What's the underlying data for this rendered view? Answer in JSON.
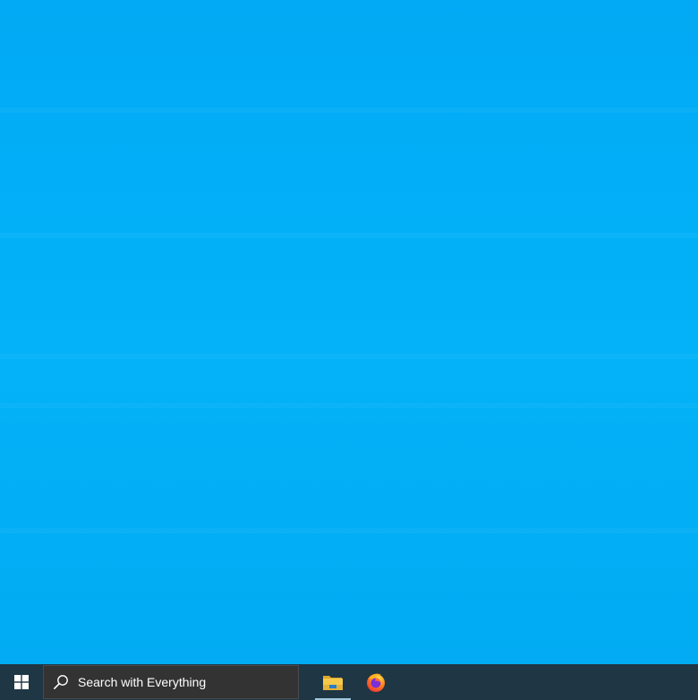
{
  "desktop": {
    "background_color": "#02aff6"
  },
  "taskbar": {
    "background_color": "#1f3644",
    "start": {
      "icon": "windows-logo-icon"
    },
    "search": {
      "placeholder": "Search with Everything",
      "icon": "search-icon"
    },
    "pinned_apps": [
      {
        "icon": "file-explorer-icon",
        "active": true
      },
      {
        "icon": "firefox-icon",
        "active": false
      }
    ]
  }
}
